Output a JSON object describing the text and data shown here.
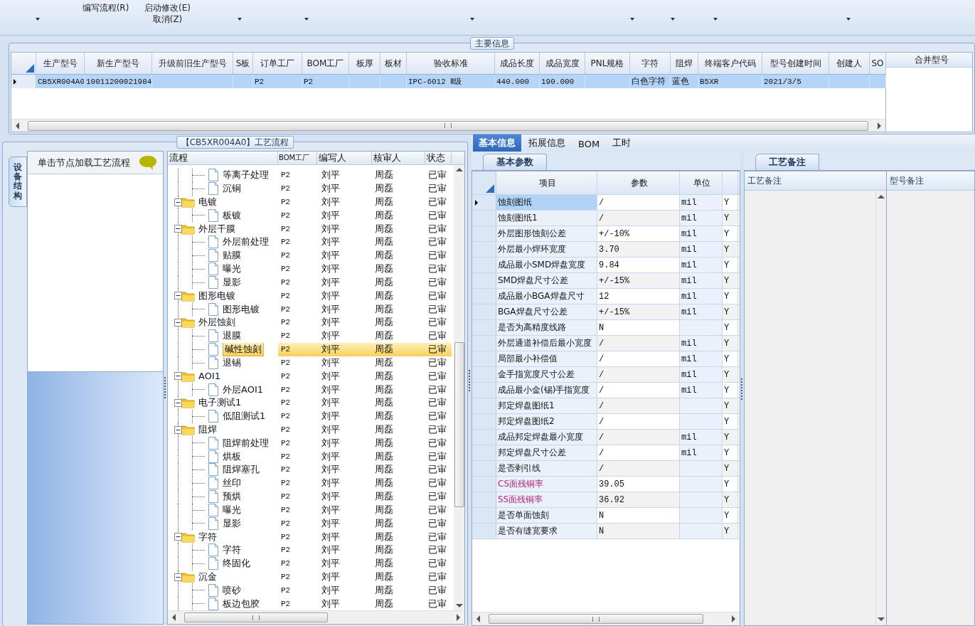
{
  "toolbar": {
    "buttons": [
      {
        "label": "编写流程(R)"
      },
      {
        "label": "启动修改(E)"
      },
      {
        "label": "取消(Z)"
      }
    ]
  },
  "main_info": {
    "title": "主要信息",
    "columns": [
      "生产型号",
      "新生产型号",
      "升级前旧生产型号",
      "S板",
      "订单工厂",
      "BOM工厂",
      "板厚",
      "板材",
      "验收标准",
      "成品长度",
      "成品宽度",
      "PNL规格",
      "字符",
      "阻焊",
      "终端客户代码",
      "型号创建时间",
      "创建人",
      "SO"
    ],
    "rows": [
      {
        "selected": true,
        "cells": [
          "CB5XR004A0",
          "10011200021984",
          null,
          null,
          "P2",
          "P2",
          null,
          null,
          "IPC-6012 Ⅱ级",
          "440.000",
          "190.000",
          null,
          "白色字符",
          "蓝色",
          "B5XR",
          "2021/3/5",
          null,
          null
        ]
      }
    ],
    "side_panel": {
      "title": "合并型号"
    }
  },
  "process_flow": {
    "title": "【CB5XR004A0】工艺流程",
    "side_tab": "设备结构",
    "hint": "单击节点加载工艺流程",
    "columns": [
      "流程",
      "BOM工厂",
      "编写人",
      "核审人",
      "状态"
    ],
    "tree": [
      {
        "children": [
          {
            "name": "等离子处理",
            "bom": "P2",
            "author": "刘平",
            "reviewer": "周磊",
            "status": "已审",
            "selected": false
          },
          {
            "name": "沉铜",
            "bom": "P2",
            "author": "刘平",
            "reviewer": "周磊",
            "status": "已审",
            "selected": false
          }
        ]
      },
      {
        "name": "电镀",
        "bom": "P2",
        "author": "刘平",
        "reviewer": "周磊",
        "status": "已审",
        "expanded": true,
        "children": [
          {
            "name": "板镀",
            "bom": "P2",
            "author": "刘平",
            "reviewer": "周磊",
            "status": "已审",
            "selected": false
          }
        ]
      },
      {
        "name": "外层干膜",
        "bom": "P2",
        "author": "刘平",
        "reviewer": "周磊",
        "status": "已审",
        "expanded": true,
        "children": [
          {
            "name": "外层前处理",
            "bom": "P2",
            "author": "刘平",
            "reviewer": "周磊",
            "status": "已审",
            "selected": false
          },
          {
            "name": "贴膜",
            "bom": "P2",
            "author": "刘平",
            "reviewer": "周磊",
            "status": "已审",
            "selected": false
          },
          {
            "name": "曝光",
            "bom": "P2",
            "author": "刘平",
            "reviewer": "周磊",
            "status": "已审",
            "selected": false
          },
          {
            "name": "显影",
            "bom": "P2",
            "author": "刘平",
            "reviewer": "周磊",
            "status": "已审",
            "selected": false
          }
        ]
      },
      {
        "name": "图形电镀",
        "bom": "P2",
        "author": "刘平",
        "reviewer": "周磊",
        "status": "已审",
        "expanded": true,
        "children": [
          {
            "name": "图形电镀",
            "bom": "P2",
            "author": "刘平",
            "reviewer": "周磊",
            "status": "已审",
            "selected": false
          }
        ]
      },
      {
        "name": "外层蚀刻",
        "bom": "P2",
        "author": "刘平",
        "reviewer": "周磊",
        "status": "已审",
        "expanded": true,
        "children": [
          {
            "name": "退膜",
            "bom": "P2",
            "author": "刘平",
            "reviewer": "周磊",
            "status": "已审",
            "selected": false
          },
          {
            "name": "碱性蚀刻",
            "bom": "P2",
            "author": "刘平",
            "reviewer": "周磊",
            "status": "已审",
            "selected": true
          },
          {
            "name": "退锡",
            "bom": "P2",
            "author": "刘平",
            "reviewer": "周磊",
            "status": "已审",
            "selected": false
          }
        ]
      },
      {
        "name": "AOI1",
        "bom": "P2",
        "author": "刘平",
        "reviewer": "周磊",
        "status": "已审",
        "expanded": true,
        "children": [
          {
            "name": "外层AOI1",
            "bom": "P2",
            "author": "刘平",
            "reviewer": "周磊",
            "status": "已审",
            "selected": false
          }
        ]
      },
      {
        "name": "电子测试1",
        "bom": "P2",
        "author": "刘平",
        "reviewer": "周磊",
        "status": "已审",
        "expanded": true,
        "children": [
          {
            "name": "低阻测试1",
            "bom": "P2",
            "author": "刘平",
            "reviewer": "周磊",
            "status": "已审",
            "selected": false
          }
        ]
      },
      {
        "name": "阻焊",
        "bom": "P2",
        "author": "刘平",
        "reviewer": "周磊",
        "status": "已审",
        "expanded": true,
        "children": [
          {
            "name": "阻焊前处理",
            "bom": "P2",
            "author": "刘平",
            "reviewer": "周磊",
            "status": "已审",
            "selected": false
          },
          {
            "name": "烘板",
            "bom": "P2",
            "author": "刘平",
            "reviewer": "周磊",
            "status": "已审",
            "selected": false
          },
          {
            "name": "阻焊塞孔",
            "bom": "P2",
            "author": "刘平",
            "reviewer": "周磊",
            "status": "已审",
            "selected": false
          },
          {
            "name": "丝印",
            "bom": "P2",
            "author": "刘平",
            "reviewer": "周磊",
            "status": "已审",
            "selected": false
          },
          {
            "name": "预烘",
            "bom": "P2",
            "author": "刘平",
            "reviewer": "周磊",
            "status": "已审",
            "selected": false
          },
          {
            "name": "曝光",
            "bom": "P2",
            "author": "刘平",
            "reviewer": "周磊",
            "status": "已审",
            "selected": false
          },
          {
            "name": "显影",
            "bom": "P2",
            "author": "刘平",
            "reviewer": "周磊",
            "status": "已审",
            "selected": false
          }
        ]
      },
      {
        "name": "字符",
        "bom": "P2",
        "author": "刘平",
        "reviewer": "周磊",
        "status": "已审",
        "expanded": true,
        "children": [
          {
            "name": "字符",
            "bom": "P2",
            "author": "刘平",
            "reviewer": "周磊",
            "status": "已审",
            "selected": false
          },
          {
            "name": "终固化",
            "bom": "P2",
            "author": "刘平",
            "reviewer": "周磊",
            "status": "已审",
            "selected": false
          }
        ]
      },
      {
        "name": "沉金",
        "bom": "P2",
        "author": "刘平",
        "reviewer": "周磊",
        "status": "已审",
        "expanded": true,
        "children": [
          {
            "name": "喷砂",
            "bom": "P2",
            "author": "刘平",
            "reviewer": "周磊",
            "status": "已审",
            "selected": false
          },
          {
            "name": "板边包胶",
            "bom": "P2",
            "author": "刘平",
            "reviewer": "周磊",
            "status": "已审",
            "selected": false
          }
        ]
      }
    ]
  },
  "detail_tabs": [
    {
      "label": "基本信息",
      "selected": true
    },
    {
      "label": "拓展信息",
      "selected": false
    },
    {
      "label": "BOM",
      "selected": false
    },
    {
      "label": "工时",
      "selected": false
    }
  ],
  "params": {
    "tab": "基本参数",
    "columns": [
      "项目",
      "参数",
      "单位"
    ],
    "rows": [
      {
        "item": "蚀刻图纸",
        "value": "/",
        "unit": "mil",
        "flag": "Y",
        "selected": true,
        "highlighted": false
      },
      {
        "item": "蚀刻图纸1",
        "value": "/",
        "unit": "mil",
        "flag": "Y",
        "selected": false,
        "highlighted": false
      },
      {
        "item": "外层图形蚀刻公差",
        "value": "+/-10%",
        "unit": "mil",
        "flag": "Y",
        "selected": false,
        "highlighted": false
      },
      {
        "item": "外层最小焊环宽度",
        "value": "3.70",
        "unit": "mil",
        "flag": "Y",
        "selected": false,
        "highlighted": false
      },
      {
        "item": "成品最小SMD焊盘宽度",
        "value": "9.84",
        "unit": "mil",
        "flag": "Y",
        "selected": false,
        "highlighted": false
      },
      {
        "item": "SMD焊盘尺寸公差",
        "value": "+/-15%",
        "unit": "mil",
        "flag": "Y",
        "selected": false,
        "highlighted": false
      },
      {
        "item": "成品最小BGA焊盘尺寸",
        "value": "12",
        "unit": "mil",
        "flag": "Y",
        "selected": false,
        "highlighted": false
      },
      {
        "item": "BGA焊盘尺寸公差",
        "value": "+/-15%",
        "unit": "mil",
        "flag": "Y",
        "selected": false,
        "highlighted": false
      },
      {
        "item": "是否为高精度线路",
        "value": "N",
        "flag": "Y",
        "selected": false,
        "highlighted": false
      },
      {
        "item": "外层通道补偿后最小宽度",
        "value": "/",
        "unit": "mil",
        "flag": "Y",
        "selected": false,
        "highlighted": false
      },
      {
        "item": "局部最小补偿值",
        "value": "/",
        "unit": "mil",
        "flag": "Y",
        "selected": false,
        "highlighted": false
      },
      {
        "item": "金手指宽度尺寸公差",
        "value": "/",
        "unit": "mil",
        "flag": "Y",
        "selected": false,
        "highlighted": false
      },
      {
        "item": "成品最小金(锡)手指宽度",
        "value": "/",
        "unit": "mil",
        "flag": "Y",
        "selected": false,
        "highlighted": false
      },
      {
        "item": "邦定焊盘图纸1",
        "value": "/",
        "flag": "Y",
        "selected": false,
        "highlighted": false
      },
      {
        "item": "邦定焊盘图纸2",
        "value": "/",
        "flag": "Y",
        "selected": false,
        "highlighted": false
      },
      {
        "item": "成品邦定焊盘最小宽度",
        "value": "/",
        "unit": "mil",
        "flag": "Y",
        "selected": false,
        "highlighted": false
      },
      {
        "item": "邦定焊盘尺寸公差",
        "value": "/",
        "unit": "mil",
        "flag": "Y",
        "selected": false,
        "highlighted": false
      },
      {
        "item": "是否剥引线",
        "value": "/",
        "flag": "Y",
        "selected": false,
        "highlighted": false
      },
      {
        "item": "CS面残铜率",
        "value": "39.05",
        "flag": "Y",
        "selected": false,
        "highlighted": true
      },
      {
        "item": "SS面残铜率",
        "value": "36.92",
        "flag": "Y",
        "selected": false,
        "highlighted": true
      },
      {
        "item": "是否单面蚀刻",
        "value": "N",
        "flag": "Y",
        "selected": false,
        "highlighted": false
      },
      {
        "item": "是否有缝宽要求",
        "value": "N",
        "flag": "Y",
        "selected": false,
        "highlighted": false
      }
    ]
  },
  "remarks": {
    "tab": "工艺备注",
    "columns": [
      "工艺备注",
      "型号备注"
    ]
  }
}
